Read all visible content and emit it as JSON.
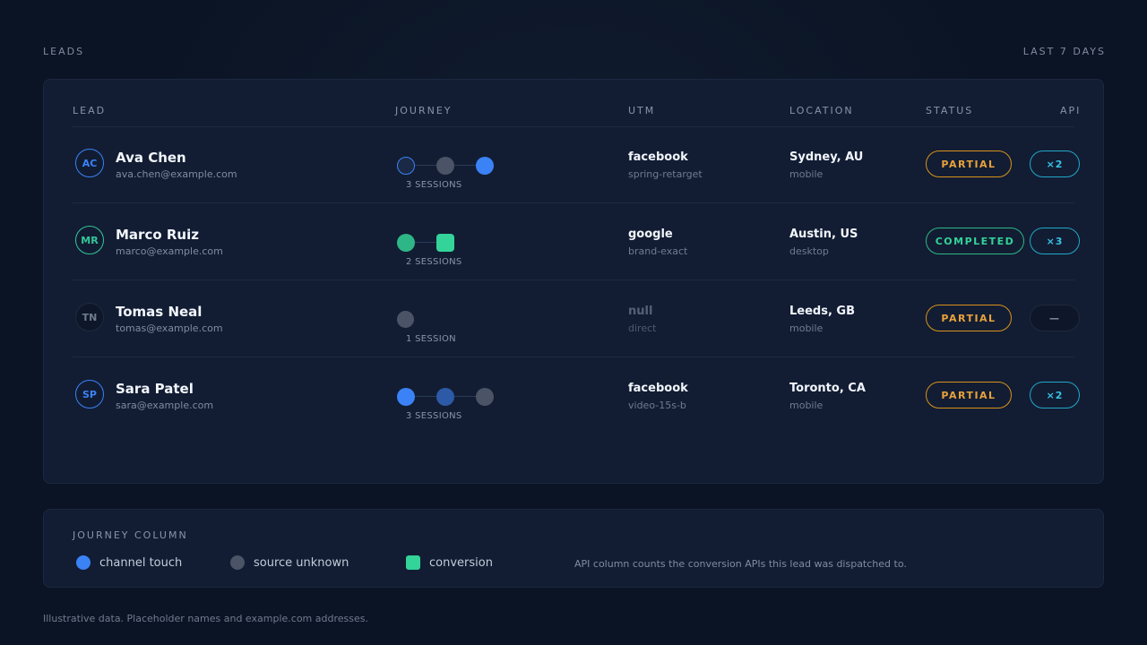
{
  "header": {
    "title": "LEADS",
    "range": "LAST 7 DAYS"
  },
  "table": {
    "columns": {
      "lead": "LEAD",
      "journey": "JOURNEY",
      "utm": "UTM",
      "location": "LOCATION",
      "status": "STATUS",
      "api": "API"
    },
    "rows": [
      {
        "initials": "AC",
        "name": "Ava Chen",
        "email": "ava.chen@example.com",
        "journey": [
          "start",
          "unknown",
          "touch"
        ],
        "sessions": "3 SESSIONS",
        "utm_source": "facebook",
        "utm_campaign": "spring-retarget",
        "city": "Sydney, AU",
        "device": "mobile",
        "status": "PARTIAL",
        "api": "×2"
      },
      {
        "initials": "MR",
        "name": "Marco Ruiz",
        "email": "marco@example.com",
        "journey": [
          "start-green",
          "conversion"
        ],
        "sessions": "2 SESSIONS",
        "utm_source": "google",
        "utm_campaign": "brand-exact",
        "city": "Austin, US",
        "device": "desktop",
        "status": "COMPLETED",
        "api": "×3"
      },
      {
        "initials": "TN",
        "name": "Tomas Neal",
        "email": "tomas@example.com",
        "journey": [
          "unknown"
        ],
        "sessions": "1 SESSION",
        "utm_source": "null",
        "utm_campaign": "direct",
        "city": "Leeds, GB",
        "device": "mobile",
        "status": "PARTIAL",
        "api": "—"
      },
      {
        "initials": "SP",
        "name": "Sara Patel",
        "email": "sara@example.com",
        "journey": [
          "touch",
          "touch-dim",
          "unknown"
        ],
        "sessions": "3 SESSIONS",
        "utm_source": "facebook",
        "utm_campaign": "video-15s-b",
        "city": "Toronto, CA",
        "device": "mobile",
        "status": "PARTIAL",
        "api": "×2"
      }
    ]
  },
  "legend": {
    "title": "JOURNEY COLUMN",
    "items": [
      {
        "label": "channel touch",
        "color": "#3b82f6",
        "shape": "circle"
      },
      {
        "label": "source unknown",
        "color": "#4b5366",
        "shape": "circle"
      },
      {
        "label": "conversion",
        "color": "#34d399",
        "shape": "square"
      }
    ],
    "note": "API column counts the conversion APIs this lead was dispatched to."
  },
  "footer": "Illustrative data. Placeholder names and example.com addresses.",
  "colors": {
    "background": "#0b1424",
    "card": "#121d33",
    "touch": "#3b82f6",
    "unknown": "#4b5366",
    "conversion": "#34d399",
    "partial": "#e9a23b",
    "completed": "#34d399",
    "api": "#38c3e6"
  }
}
